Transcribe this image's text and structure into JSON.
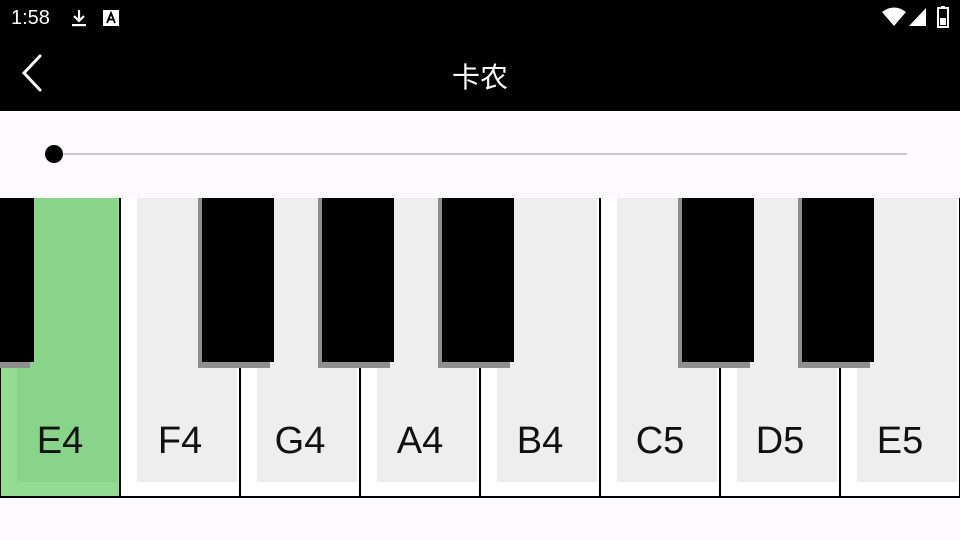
{
  "status_bar": {
    "time": "1:58",
    "icons": [
      "download-icon",
      "font-a-icon",
      "wifi-icon",
      "cell-signal-icon",
      "battery-icon"
    ]
  },
  "app_bar": {
    "title": "卡农",
    "back_icon": "chevron-left-icon"
  },
  "slider": {
    "value": 0
  },
  "keyboard": {
    "active_key": "E4",
    "active_color": "#8fd98e",
    "white_keys": [
      {
        "label": "E4"
      },
      {
        "label": "F4"
      },
      {
        "label": "G4"
      },
      {
        "label": "A4"
      },
      {
        "label": "B4"
      },
      {
        "label": "C5"
      },
      {
        "label": "D5"
      },
      {
        "label": "E5"
      }
    ]
  }
}
